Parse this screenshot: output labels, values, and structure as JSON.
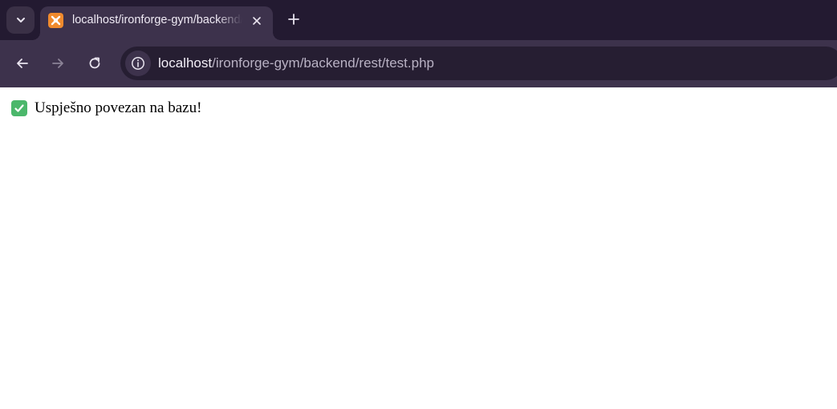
{
  "browser": {
    "tab": {
      "title": "localhost/ironforge-gym/backend/rest/test.php",
      "favicon": "xampp-icon"
    },
    "omnibox": {
      "url_host": "localhost",
      "url_path": "/ironforge-gym/backend/rest/test.php"
    },
    "icons": {
      "tab_search": "chevron-down-icon",
      "close": "close-icon",
      "new_tab": "plus-icon",
      "back": "arrow-left-icon",
      "forward": "arrow-right-icon",
      "reload": "reload-icon",
      "site_info": "info-icon"
    },
    "colors": {
      "tabstrip": "#231a31",
      "toolbar": "#3d324c",
      "omnibox": "#261e32",
      "favicon": "#f08a2d",
      "check": "#4bb76b"
    }
  },
  "page": {
    "message_icon": "check-mark-button-icon",
    "message": "Uspješno povezan na bazu!"
  }
}
